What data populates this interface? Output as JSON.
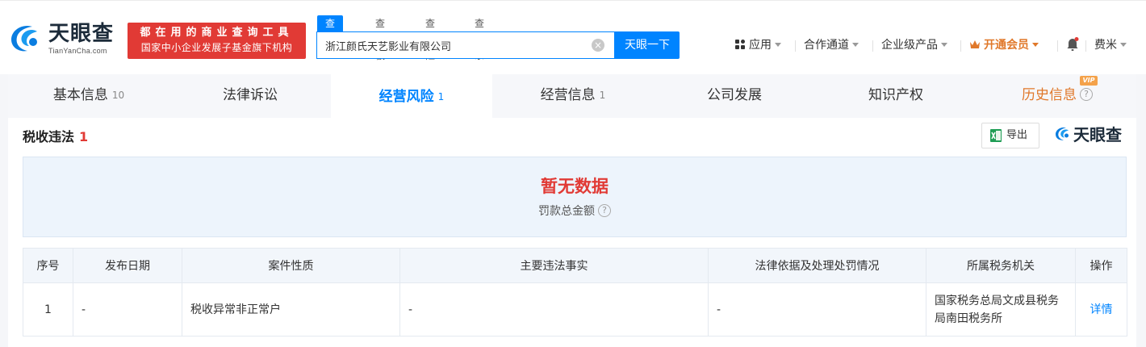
{
  "header": {
    "logo": {
      "title": "天眼查",
      "subtitle": "TianYanCha.com"
    },
    "promo": {
      "line1": "都在用的商业查询工具",
      "line2": "国家中小企业发展子基金旗下机构"
    },
    "search": {
      "tabs": [
        "查公司",
        "查老板",
        "查风险",
        "查关系"
      ],
      "active_tab": "查公司",
      "value": "浙江颜氏天艺影业有限公司",
      "clear_glyph": "×",
      "button": "天眼一下"
    },
    "nav": {
      "apps": "应用",
      "channel": "合作通道",
      "enterprise": "企业级产品",
      "vip": "开通会员",
      "user": "费米"
    }
  },
  "tabs": [
    {
      "label": "基本信息",
      "count": "10"
    },
    {
      "label": "法律诉讼",
      "count": ""
    },
    {
      "label": "经营风险",
      "count": "1"
    },
    {
      "label": "经营信息",
      "count": "1"
    },
    {
      "label": "公司发展",
      "count": ""
    },
    {
      "label": "知识产权",
      "count": ""
    },
    {
      "label": "历史信息",
      "count": "",
      "badge": "VIP"
    }
  ],
  "section": {
    "title": "税收违法",
    "count": "1",
    "export_label": "导出",
    "brand": "天眼查"
  },
  "summary": {
    "value": "暂无数据",
    "label": "罚款总金额",
    "help": "?"
  },
  "table": {
    "headers": [
      "序号",
      "发布日期",
      "案件性质",
      "主要违法事实",
      "法律依据及处理处罚情况",
      "所属税务机关",
      "操作"
    ],
    "rows": [
      [
        "1",
        "-",
        "税收异常非正常户",
        "-",
        "-",
        "国家税务总局文成县税务局南田税务所",
        "详情"
      ]
    ]
  },
  "colors": {
    "accent": "#0084ff",
    "danger": "#e13a35",
    "vip": "#e0782a"
  }
}
